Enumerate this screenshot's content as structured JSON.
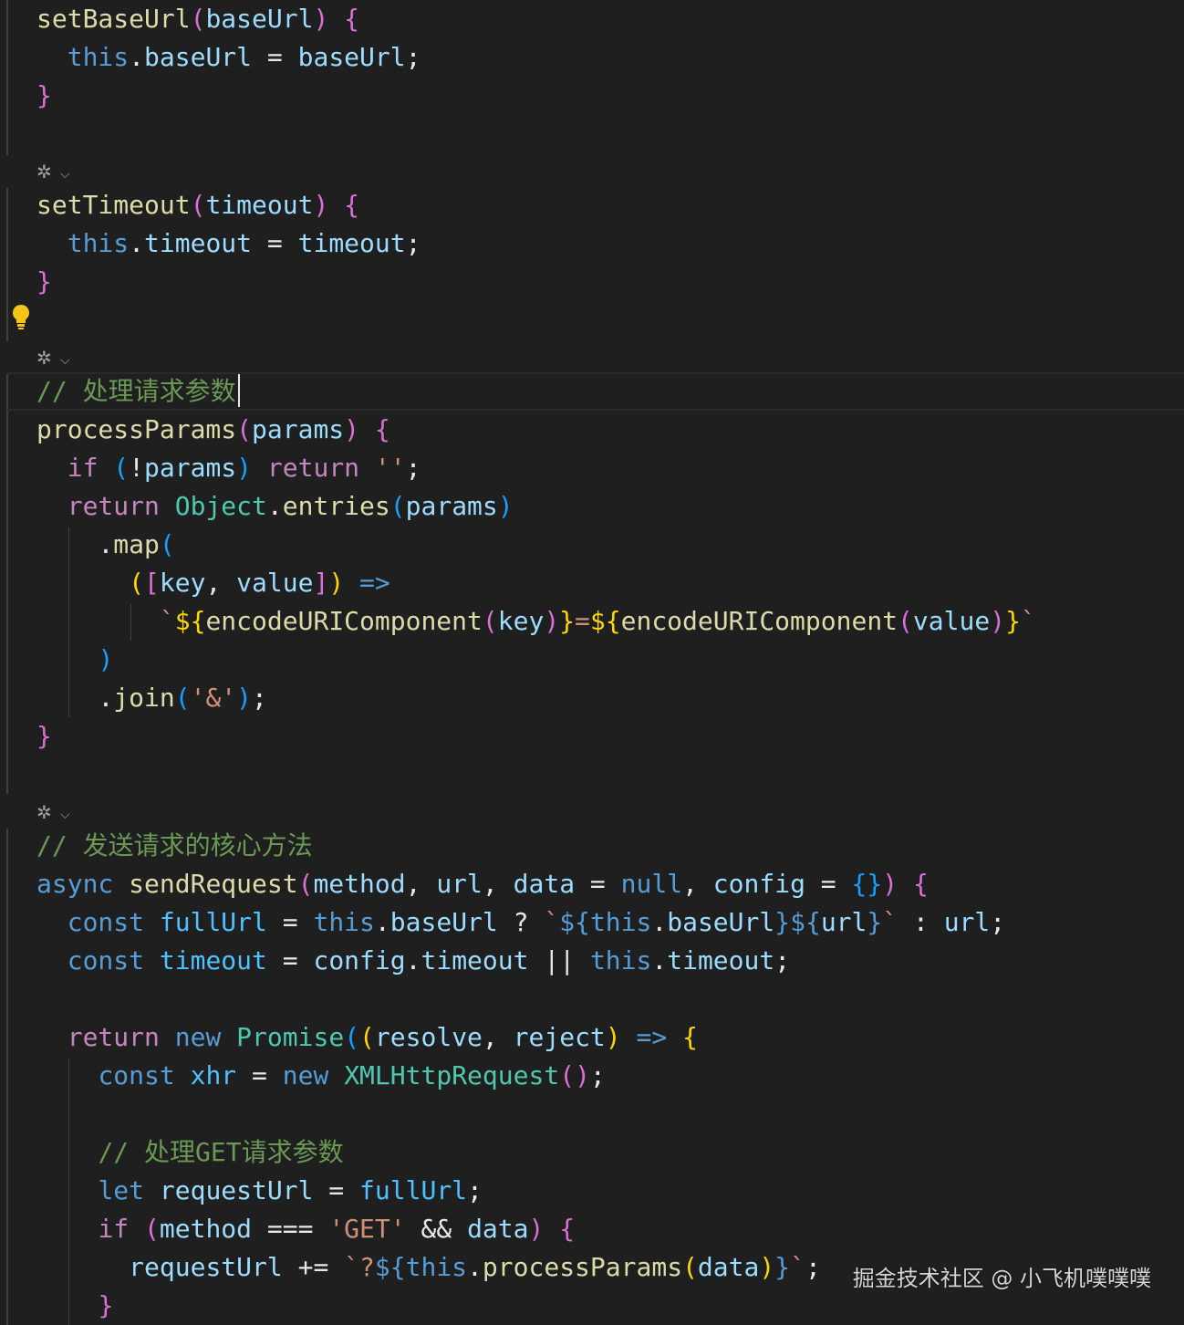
{
  "colors": {
    "background": "#1f1f1f",
    "default_text": "#e8e8e8",
    "keyword_blue": "#569cd6",
    "control_pink": "#c586c0",
    "function_yellow": "#dcdcaa",
    "variable_lightblue": "#9cdcfe",
    "property_cyan": "#4fc1ff",
    "type_teal": "#4ec9b0",
    "string_orange": "#ce9178",
    "comment_green": "#6a9955",
    "bracket_gold": "#ffd700",
    "bracket_pink": "#da70d6",
    "bracket_blue": "#179fff"
  },
  "codelens": {
    "icon": "ai-sparkle-icon",
    "chevron": "chevron-down-icon",
    "icon_glyph": "✲",
    "chevron_glyph": "⌵"
  },
  "lightbulb": {
    "icon": "lightbulb-icon"
  },
  "watermark": {
    "text": "掘金技术社区 @ 小飞机噗噗噗"
  },
  "code": {
    "lines": [
      {
        "tokens": [
          {
            "t": "setBaseUrl",
            "c": "function_yellow"
          },
          {
            "t": "(",
            "c": "bracket_pink"
          },
          {
            "t": "baseUrl",
            "c": "variable_lightblue"
          },
          {
            "t": ")",
            "c": "bracket_pink"
          },
          {
            "t": " ",
            "c": "default_text"
          },
          {
            "t": "{",
            "c": "bracket_pink"
          }
        ]
      },
      {
        "tokens": [
          {
            "t": "  ",
            "c": "default_text"
          },
          {
            "t": "this",
            "c": "keyword_blue"
          },
          {
            "t": ".",
            "c": "default_text"
          },
          {
            "t": "baseUrl",
            "c": "variable_lightblue"
          },
          {
            "t": " = ",
            "c": "default_text"
          },
          {
            "t": "baseUrl",
            "c": "variable_lightblue"
          },
          {
            "t": ";",
            "c": "default_text"
          }
        ]
      },
      {
        "tokens": [
          {
            "t": "}",
            "c": "bracket_pink"
          }
        ]
      },
      {
        "tokens": [
          {
            "t": "setTimeout",
            "c": "function_yellow"
          },
          {
            "t": "(",
            "c": "bracket_pink"
          },
          {
            "t": "timeout",
            "c": "variable_lightblue"
          },
          {
            "t": ")",
            "c": "bracket_pink"
          },
          {
            "t": " ",
            "c": "default_text"
          },
          {
            "t": "{",
            "c": "bracket_pink"
          }
        ]
      },
      {
        "tokens": [
          {
            "t": "  ",
            "c": "default_text"
          },
          {
            "t": "this",
            "c": "keyword_blue"
          },
          {
            "t": ".",
            "c": "default_text"
          },
          {
            "t": "timeout",
            "c": "variable_lightblue"
          },
          {
            "t": " = ",
            "c": "default_text"
          },
          {
            "t": "timeout",
            "c": "variable_lightblue"
          },
          {
            "t": ";",
            "c": "default_text"
          }
        ]
      },
      {
        "tokens": [
          {
            "t": "}",
            "c": "bracket_pink"
          }
        ]
      },
      {
        "tokens": [
          {
            "t": "// 处理请求参数",
            "c": "comment_green"
          }
        ]
      },
      {
        "tokens": [
          {
            "t": "processParams",
            "c": "function_yellow"
          },
          {
            "t": "(",
            "c": "bracket_pink"
          },
          {
            "t": "params",
            "c": "variable_lightblue"
          },
          {
            "t": ")",
            "c": "bracket_pink"
          },
          {
            "t": " ",
            "c": "default_text"
          },
          {
            "t": "{",
            "c": "bracket_pink"
          }
        ]
      },
      {
        "tokens": [
          {
            "t": "  ",
            "c": "default_text"
          },
          {
            "t": "if",
            "c": "control_pink"
          },
          {
            "t": " ",
            "c": "default_text"
          },
          {
            "t": "(",
            "c": "bracket_blue"
          },
          {
            "t": "!",
            "c": "default_text"
          },
          {
            "t": "params",
            "c": "variable_lightblue"
          },
          {
            "t": ")",
            "c": "bracket_blue"
          },
          {
            "t": " ",
            "c": "default_text"
          },
          {
            "t": "return",
            "c": "control_pink"
          },
          {
            "t": " ",
            "c": "default_text"
          },
          {
            "t": "''",
            "c": "string_orange"
          },
          {
            "t": ";",
            "c": "default_text"
          }
        ]
      },
      {
        "tokens": [
          {
            "t": "  ",
            "c": "default_text"
          },
          {
            "t": "return",
            "c": "control_pink"
          },
          {
            "t": " ",
            "c": "default_text"
          },
          {
            "t": "Object",
            "c": "type_teal"
          },
          {
            "t": ".",
            "c": "default_text"
          },
          {
            "t": "entries",
            "c": "function_yellow"
          },
          {
            "t": "(",
            "c": "bracket_blue"
          },
          {
            "t": "params",
            "c": "variable_lightblue"
          },
          {
            "t": ")",
            "c": "bracket_blue"
          }
        ]
      },
      {
        "tokens": [
          {
            "t": "    ",
            "c": "default_text"
          },
          {
            "t": ".",
            "c": "default_text"
          },
          {
            "t": "map",
            "c": "function_yellow"
          },
          {
            "t": "(",
            "c": "bracket_blue"
          }
        ]
      },
      {
        "tokens": [
          {
            "t": "      ",
            "c": "default_text"
          },
          {
            "t": "(",
            "c": "bracket_gold"
          },
          {
            "t": "[",
            "c": "bracket_pink"
          },
          {
            "t": "key",
            "c": "variable_lightblue"
          },
          {
            "t": ", ",
            "c": "default_text"
          },
          {
            "t": "value",
            "c": "variable_lightblue"
          },
          {
            "t": "]",
            "c": "bracket_pink"
          },
          {
            "t": ")",
            "c": "bracket_gold"
          },
          {
            "t": " ",
            "c": "default_text"
          },
          {
            "t": "=>",
            "c": "keyword_blue"
          }
        ]
      },
      {
        "tokens": [
          {
            "t": "        ",
            "c": "default_text"
          },
          {
            "t": "`",
            "c": "string_orange"
          },
          {
            "t": "${",
            "c": "bracket_gold"
          },
          {
            "t": "encodeURIComponent",
            "c": "function_yellow"
          },
          {
            "t": "(",
            "c": "bracket_pink"
          },
          {
            "t": "key",
            "c": "variable_lightblue"
          },
          {
            "t": ")",
            "c": "bracket_pink"
          },
          {
            "t": "}",
            "c": "bracket_gold"
          },
          {
            "t": "=",
            "c": "string_orange"
          },
          {
            "t": "${",
            "c": "bracket_gold"
          },
          {
            "t": "encodeURIComponent",
            "c": "function_yellow"
          },
          {
            "t": "(",
            "c": "bracket_pink"
          },
          {
            "t": "value",
            "c": "variable_lightblue"
          },
          {
            "t": ")",
            "c": "bracket_pink"
          },
          {
            "t": "}",
            "c": "bracket_gold"
          },
          {
            "t": "`",
            "c": "string_orange"
          }
        ]
      },
      {
        "tokens": [
          {
            "t": "    ",
            "c": "default_text"
          },
          {
            "t": ")",
            "c": "bracket_blue"
          }
        ]
      },
      {
        "tokens": [
          {
            "t": "    ",
            "c": "default_text"
          },
          {
            "t": ".",
            "c": "default_text"
          },
          {
            "t": "join",
            "c": "function_yellow"
          },
          {
            "t": "(",
            "c": "bracket_blue"
          },
          {
            "t": "'&'",
            "c": "string_orange"
          },
          {
            "t": ")",
            "c": "bracket_blue"
          },
          {
            "t": ";",
            "c": "default_text"
          }
        ]
      },
      {
        "tokens": [
          {
            "t": "}",
            "c": "bracket_pink"
          }
        ]
      },
      {
        "tokens": [
          {
            "t": "// 发送请求的核心方法",
            "c": "comment_green"
          }
        ]
      },
      {
        "tokens": [
          {
            "t": "async",
            "c": "keyword_blue"
          },
          {
            "t": " ",
            "c": "default_text"
          },
          {
            "t": "sendRequest",
            "c": "function_yellow"
          },
          {
            "t": "(",
            "c": "bracket_pink"
          },
          {
            "t": "method",
            "c": "variable_lightblue"
          },
          {
            "t": ", ",
            "c": "default_text"
          },
          {
            "t": "url",
            "c": "variable_lightblue"
          },
          {
            "t": ", ",
            "c": "default_text"
          },
          {
            "t": "data",
            "c": "variable_lightblue"
          },
          {
            "t": " = ",
            "c": "default_text"
          },
          {
            "t": "null",
            "c": "keyword_blue"
          },
          {
            "t": ", ",
            "c": "default_text"
          },
          {
            "t": "config",
            "c": "variable_lightblue"
          },
          {
            "t": " = ",
            "c": "default_text"
          },
          {
            "t": "{}",
            "c": "bracket_blue"
          },
          {
            "t": ")",
            "c": "bracket_pink"
          },
          {
            "t": " ",
            "c": "default_text"
          },
          {
            "t": "{",
            "c": "bracket_pink"
          }
        ]
      },
      {
        "tokens": [
          {
            "t": "  ",
            "c": "default_text"
          },
          {
            "t": "const",
            "c": "keyword_blue"
          },
          {
            "t": " ",
            "c": "default_text"
          },
          {
            "t": "fullUrl",
            "c": "property_cyan"
          },
          {
            "t": " = ",
            "c": "default_text"
          },
          {
            "t": "this",
            "c": "keyword_blue"
          },
          {
            "t": ".",
            "c": "default_text"
          },
          {
            "t": "baseUrl",
            "c": "variable_lightblue"
          },
          {
            "t": " ? ",
            "c": "default_text"
          },
          {
            "t": "`",
            "c": "string_orange"
          },
          {
            "t": "${",
            "c": "keyword_blue"
          },
          {
            "t": "this",
            "c": "keyword_blue"
          },
          {
            "t": ".",
            "c": "default_text"
          },
          {
            "t": "baseUrl",
            "c": "variable_lightblue"
          },
          {
            "t": "}",
            "c": "keyword_blue"
          },
          {
            "t": "${",
            "c": "keyword_blue"
          },
          {
            "t": "url",
            "c": "variable_lightblue"
          },
          {
            "t": "}",
            "c": "keyword_blue"
          },
          {
            "t": "`",
            "c": "string_orange"
          },
          {
            "t": " : ",
            "c": "default_text"
          },
          {
            "t": "url",
            "c": "variable_lightblue"
          },
          {
            "t": ";",
            "c": "default_text"
          }
        ]
      },
      {
        "tokens": [
          {
            "t": "  ",
            "c": "default_text"
          },
          {
            "t": "const",
            "c": "keyword_blue"
          },
          {
            "t": " ",
            "c": "default_text"
          },
          {
            "t": "timeout",
            "c": "property_cyan"
          },
          {
            "t": " = ",
            "c": "default_text"
          },
          {
            "t": "config",
            "c": "variable_lightblue"
          },
          {
            "t": ".",
            "c": "default_text"
          },
          {
            "t": "timeout",
            "c": "variable_lightblue"
          },
          {
            "t": " || ",
            "c": "default_text"
          },
          {
            "t": "this",
            "c": "keyword_blue"
          },
          {
            "t": ".",
            "c": "default_text"
          },
          {
            "t": "timeout",
            "c": "variable_lightblue"
          },
          {
            "t": ";",
            "c": "default_text"
          }
        ]
      },
      {
        "tokens": [
          {
            "t": "  ",
            "c": "default_text"
          },
          {
            "t": "return",
            "c": "control_pink"
          },
          {
            "t": " ",
            "c": "default_text"
          },
          {
            "t": "new",
            "c": "keyword_blue"
          },
          {
            "t": " ",
            "c": "default_text"
          },
          {
            "t": "Promise",
            "c": "type_teal"
          },
          {
            "t": "(",
            "c": "bracket_blue"
          },
          {
            "t": "(",
            "c": "bracket_gold"
          },
          {
            "t": "resolve",
            "c": "variable_lightblue"
          },
          {
            "t": ", ",
            "c": "default_text"
          },
          {
            "t": "reject",
            "c": "variable_lightblue"
          },
          {
            "t": ")",
            "c": "bracket_gold"
          },
          {
            "t": " ",
            "c": "default_text"
          },
          {
            "t": "=>",
            "c": "keyword_blue"
          },
          {
            "t": " ",
            "c": "default_text"
          },
          {
            "t": "{",
            "c": "bracket_gold"
          }
        ]
      },
      {
        "tokens": [
          {
            "t": "    ",
            "c": "default_text"
          },
          {
            "t": "const",
            "c": "keyword_blue"
          },
          {
            "t": " ",
            "c": "default_text"
          },
          {
            "t": "xhr",
            "c": "property_cyan"
          },
          {
            "t": " = ",
            "c": "default_text"
          },
          {
            "t": "new",
            "c": "keyword_blue"
          },
          {
            "t": " ",
            "c": "default_text"
          },
          {
            "t": "XMLHttpRequest",
            "c": "type_teal"
          },
          {
            "t": "(",
            "c": "bracket_pink"
          },
          {
            "t": ")",
            "c": "bracket_pink"
          },
          {
            "t": ";",
            "c": "default_text"
          }
        ]
      },
      {
        "tokens": [
          {
            "t": "    ",
            "c": "default_text"
          },
          {
            "t": "// 处理GET请求参数",
            "c": "comment_green"
          }
        ]
      },
      {
        "tokens": [
          {
            "t": "    ",
            "c": "default_text"
          },
          {
            "t": "let",
            "c": "keyword_blue"
          },
          {
            "t": " ",
            "c": "default_text"
          },
          {
            "t": "requestUrl",
            "c": "variable_lightblue"
          },
          {
            "t": " = ",
            "c": "default_text"
          },
          {
            "t": "fullUrl",
            "c": "property_cyan"
          },
          {
            "t": ";",
            "c": "default_text"
          }
        ]
      },
      {
        "tokens": [
          {
            "t": "    ",
            "c": "default_text"
          },
          {
            "t": "if",
            "c": "control_pink"
          },
          {
            "t": " ",
            "c": "default_text"
          },
          {
            "t": "(",
            "c": "bracket_pink"
          },
          {
            "t": "method",
            "c": "variable_lightblue"
          },
          {
            "t": " === ",
            "c": "default_text"
          },
          {
            "t": "'GET'",
            "c": "string_orange"
          },
          {
            "t": " && ",
            "c": "default_text"
          },
          {
            "t": "data",
            "c": "variable_lightblue"
          },
          {
            "t": ")",
            "c": "bracket_pink"
          },
          {
            "t": " ",
            "c": "default_text"
          },
          {
            "t": "{",
            "c": "bracket_pink"
          }
        ]
      },
      {
        "tokens": [
          {
            "t": "      ",
            "c": "default_text"
          },
          {
            "t": "requestUrl",
            "c": "variable_lightblue"
          },
          {
            "t": " += ",
            "c": "default_text"
          },
          {
            "t": "`?",
            "c": "string_orange"
          },
          {
            "t": "${",
            "c": "keyword_blue"
          },
          {
            "t": "this",
            "c": "keyword_blue"
          },
          {
            "t": ".",
            "c": "default_text"
          },
          {
            "t": "processParams",
            "c": "function_yellow"
          },
          {
            "t": "(",
            "c": "bracket_gold"
          },
          {
            "t": "data",
            "c": "variable_lightblue"
          },
          {
            "t": ")",
            "c": "bracket_gold"
          },
          {
            "t": "}",
            "c": "keyword_blue"
          },
          {
            "t": "`",
            "c": "string_orange"
          },
          {
            "t": ";",
            "c": "default_text"
          }
        ]
      },
      {
        "tokens": [
          {
            "t": "    ",
            "c": "default_text"
          },
          {
            "t": "}",
            "c": "bracket_pink"
          }
        ]
      }
    ]
  }
}
